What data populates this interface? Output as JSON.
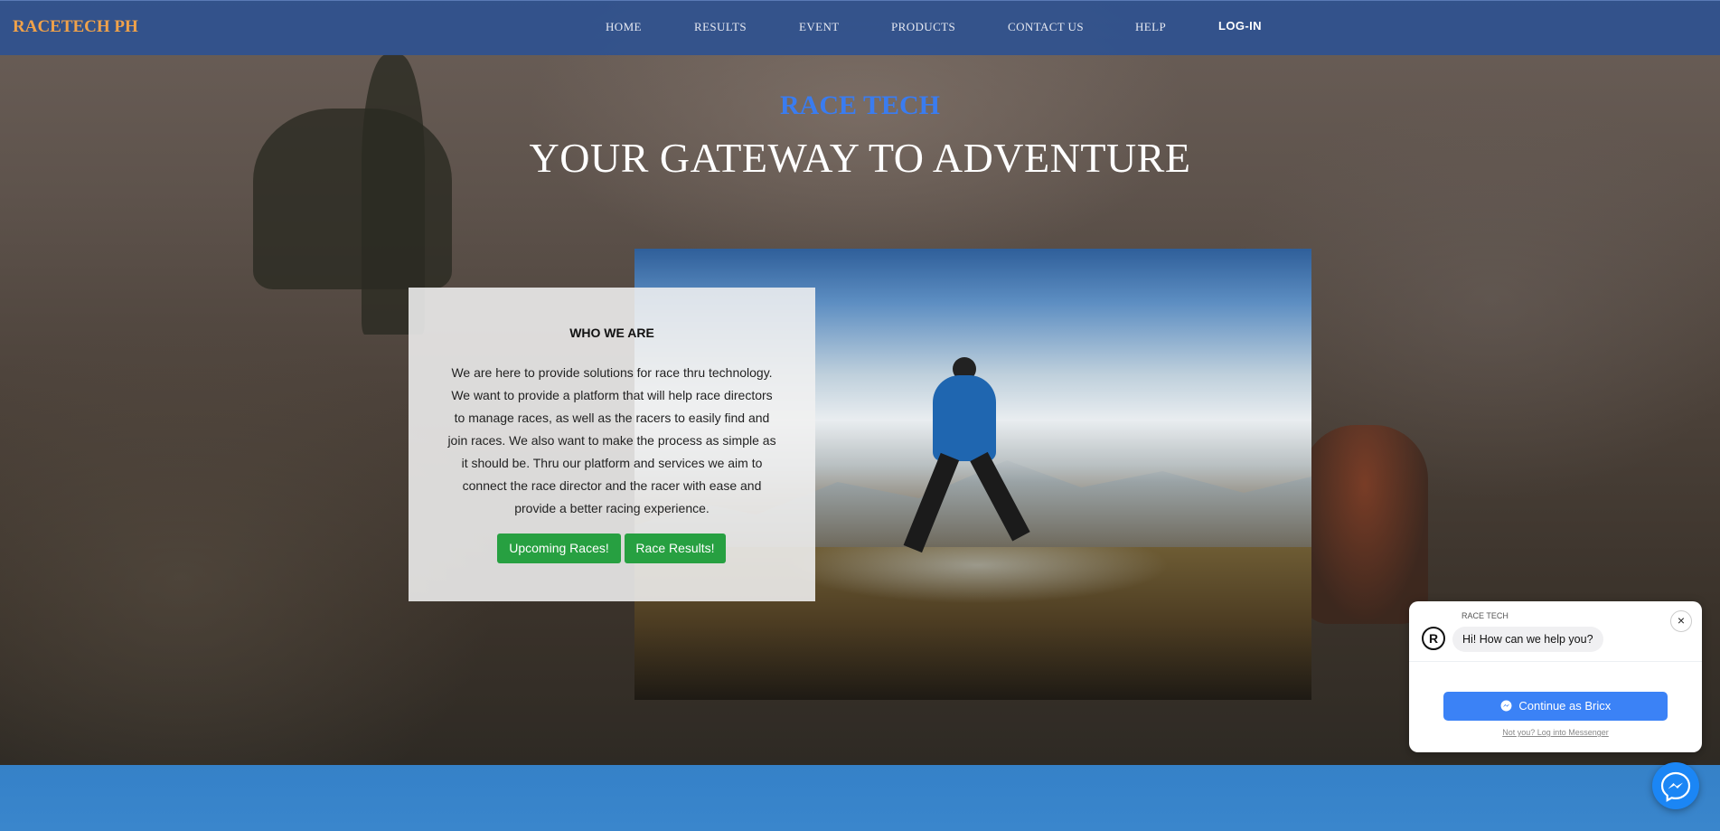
{
  "nav": {
    "brand": "RACETECH PH",
    "items": [
      {
        "label": "HOME"
      },
      {
        "label": "RESULTS"
      },
      {
        "label": "EVENT"
      },
      {
        "label": "PRODUCTS"
      },
      {
        "label": "CONTACT US"
      },
      {
        "label": "HELP"
      },
      {
        "label": "LOG-IN"
      }
    ]
  },
  "hero": {
    "kicker": "RACE TECH",
    "title": "YOUR GATEWAY TO ADVENTURE"
  },
  "about": {
    "title": "WHO WE ARE",
    "text": "We are here to provide solutions for race thru technology. We want to provide a platform that will help race directors to manage races, as well as the racers to easily find and join races. We also want to make the process as simple as it should be. Thru our platform and services we aim to connect the race director and the racer with ease and provide a better racing experience.",
    "buttons": [
      {
        "label": "Upcoming Races!"
      },
      {
        "label": "Race Results!"
      }
    ]
  },
  "chat": {
    "page_name": "RACE TECH",
    "greeting": "Hi! How can we help you?",
    "close_glyph": "×",
    "continue_label": "Continue as Bricx",
    "alt_link": "Not you? Log into Messenger"
  },
  "colors": {
    "navbar": "#2f528f",
    "brand": "#f0a24a",
    "kicker": "#3a7cf0",
    "button_green": "#27a041",
    "messenger_blue": "#1b86f5"
  },
  "icons": [
    "messenger-icon",
    "race-tech-logo-icon",
    "close-icon"
  ]
}
